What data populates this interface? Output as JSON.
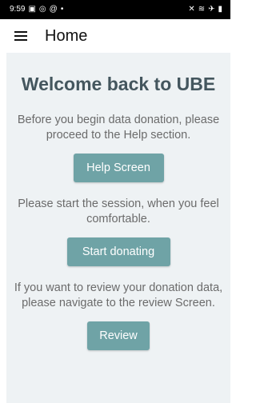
{
  "status_bar": {
    "time": "9:59",
    "left_icons": [
      "gallery-icon",
      "camera-icon",
      "at-icon",
      "dot-icon"
    ],
    "right_icons": [
      "mute-icon",
      "wifi-icon",
      "airplane-icon",
      "battery-icon"
    ]
  },
  "app_bar": {
    "title": "Home",
    "menu_icon": "hamburger-menu-icon"
  },
  "main": {
    "welcome": "Welcome back to UBE",
    "help_text": "Before you begin data donation, please proceed to the Help section.",
    "help_button": "Help Screen",
    "session_text": "Please start the session, when you feel comfortable.",
    "donate_button": "Start donating",
    "review_text": "If you want to review your donation data, please navigate to the review Screen.",
    "review_button": "Review"
  },
  "colors": {
    "accent": "#6fa3a6",
    "heading": "#44565e",
    "background": "#eef2f4"
  }
}
